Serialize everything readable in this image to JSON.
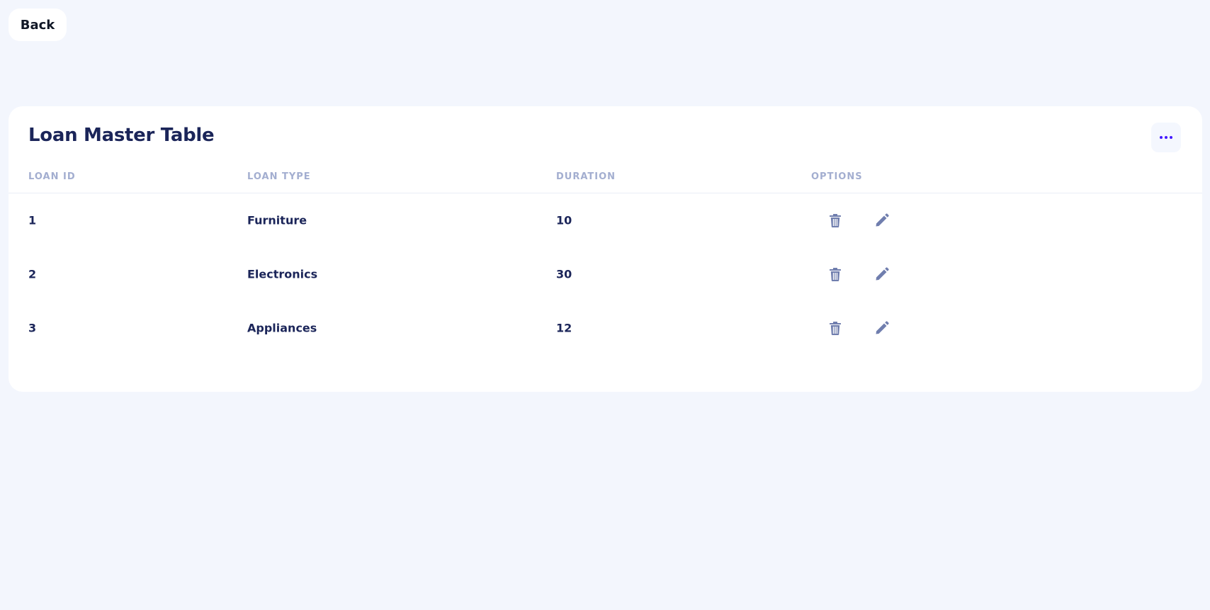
{
  "nav": {
    "back_label": "Back"
  },
  "card": {
    "title": "Loan Master Table"
  },
  "table": {
    "columns": [
      "LOAN ID",
      "LOAN TYPE",
      "DURATION",
      "OPTIONS"
    ],
    "rows": [
      {
        "id": "1",
        "type": "Furniture",
        "duration": "10"
      },
      {
        "id": "2",
        "type": "Electronics",
        "duration": "30"
      },
      {
        "id": "3",
        "type": "Appliances",
        "duration": "12"
      }
    ]
  },
  "icons": {
    "menu": "more-horizontal-icon",
    "delete": "trash-icon",
    "edit": "pencil-icon"
  },
  "colors": {
    "background": "#f3f6fd",
    "heading": "#1b2559",
    "muted": "#a3aed0",
    "accent": "#4318ff",
    "icon": "#707eae"
  }
}
